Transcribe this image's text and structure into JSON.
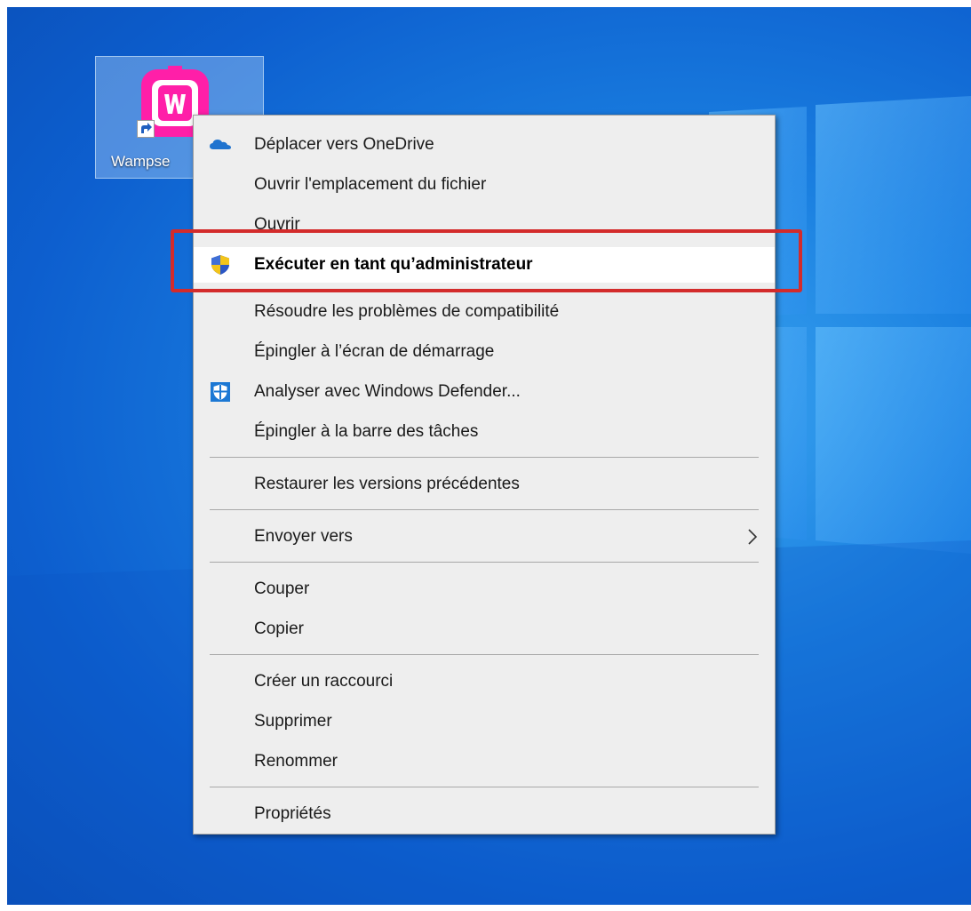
{
  "desktop": {
    "shortcut": {
      "label": "Wampse",
      "icon": "wampserver-icon"
    }
  },
  "context_menu": {
    "items": [
      {
        "label": "Déplacer vers OneDrive",
        "icon": "onedrive-icon"
      },
      {
        "label": "Ouvrir l'emplacement du fichier"
      },
      {
        "label": "Ouvrir"
      },
      {
        "label": "Exécuter en tant qu’administrateur",
        "icon": "uac-shield-icon",
        "highlighted": true
      },
      {
        "label": "Résoudre les problèmes de compatibilité"
      },
      {
        "label": "Épingler à l’écran de démarrage"
      },
      {
        "label": "Analyser avec Windows Defender...",
        "icon": "windows-defender-icon"
      },
      {
        "label": "Épingler à la barre des tâches"
      },
      {
        "label": "Restaurer les versions précédentes"
      },
      {
        "label": "Envoyer vers",
        "submenu": true
      },
      {
        "label": "Couper"
      },
      {
        "label": "Copier"
      },
      {
        "label": "Créer un raccourci"
      },
      {
        "label": "Supprimer"
      },
      {
        "label": "Renommer"
      },
      {
        "label": "Propriétés"
      }
    ]
  },
  "colors": {
    "highlight_border": "#d32b2b",
    "wamp_pink": "#ff1fa8",
    "onedrive_blue": "#1f73cf"
  }
}
